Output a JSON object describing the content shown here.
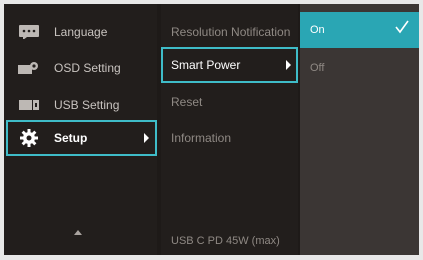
{
  "left_menu": {
    "items": [
      {
        "label": "Language",
        "icon": "language-icon"
      },
      {
        "label": "OSD Setting",
        "icon": "osd-setting-icon"
      },
      {
        "label": "USB Setting",
        "icon": "usb-setting-icon"
      },
      {
        "label": "Setup",
        "icon": "gear-icon",
        "selected": true
      }
    ],
    "scroll_up_icon": "chevron-up-icon"
  },
  "middle_menu": {
    "items": [
      {
        "label": "Resolution Notification"
      },
      {
        "label": "Smart Power",
        "selected": true
      },
      {
        "label": "Reset"
      },
      {
        "label": "Information"
      }
    ],
    "footer": "USB C PD 45W (max)"
  },
  "right_menu": {
    "options": [
      {
        "label": "On",
        "selected": true
      },
      {
        "label": "Off"
      }
    ],
    "check_icon": "checkmark-icon"
  },
  "colors": {
    "accent": "#3fbcc8",
    "active_fill": "#2aa6b4",
    "panel_dark": "#221e1c",
    "panel_right": "#3b3634"
  }
}
